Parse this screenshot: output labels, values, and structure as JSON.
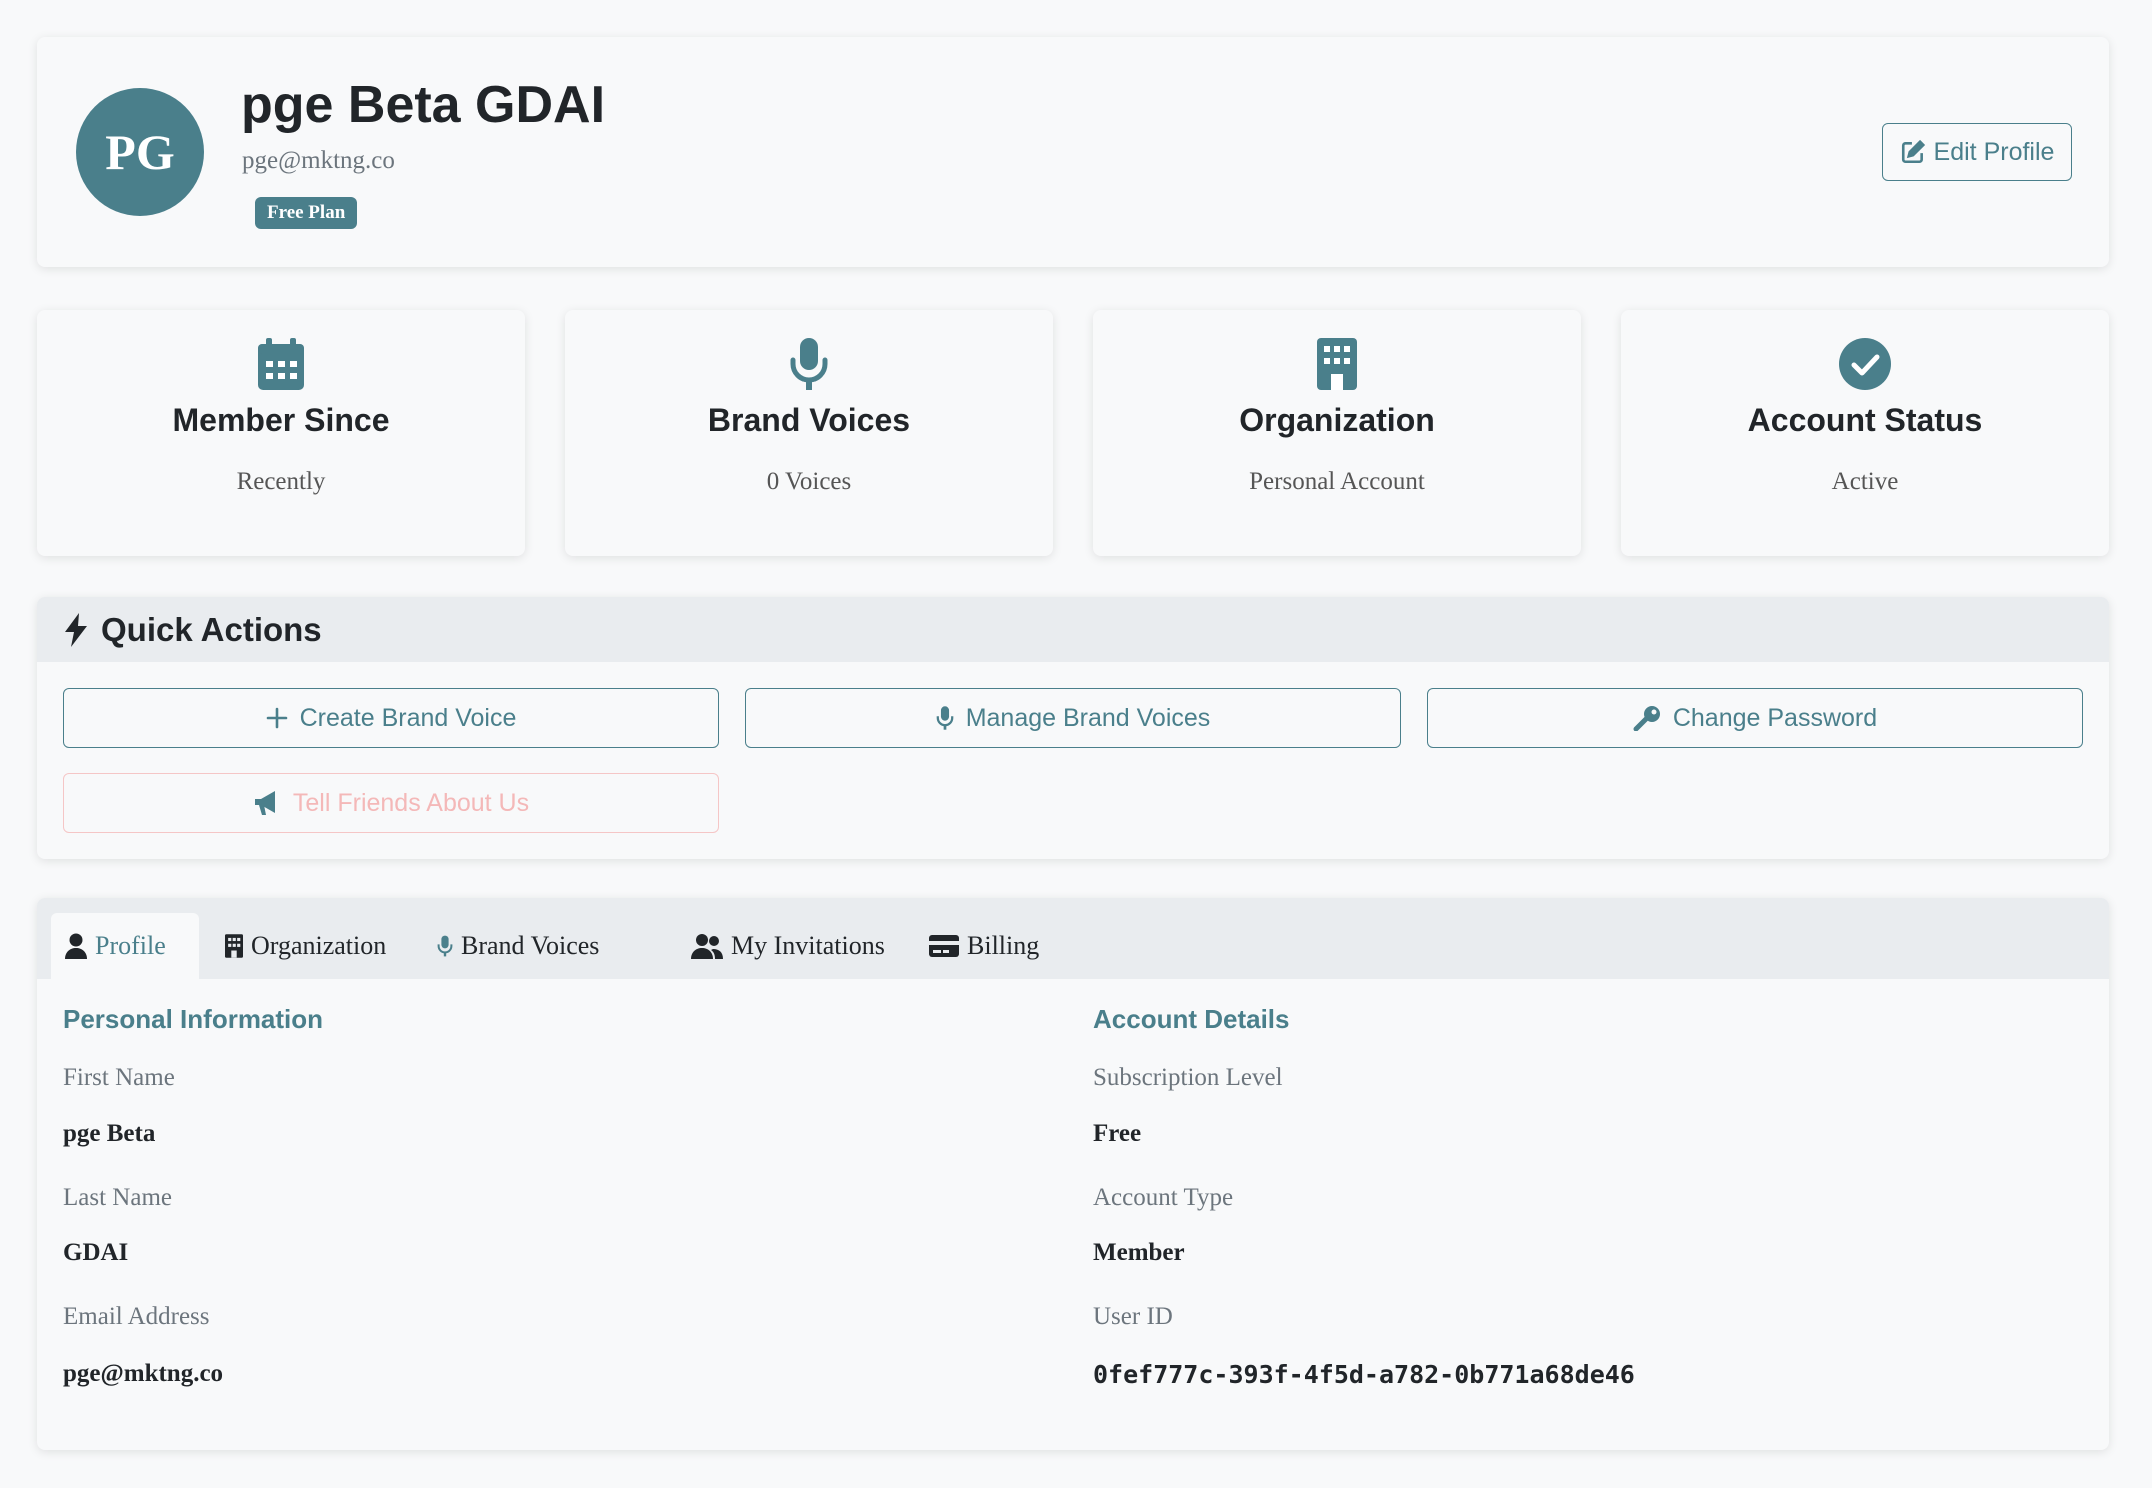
{
  "header": {
    "initials": "PG",
    "name": "pge Beta GDAI",
    "email": "pge@mktng.co",
    "plan_badge": "Free Plan",
    "edit_label": "Edit Profile"
  },
  "stats": [
    {
      "icon": "calendar-icon",
      "title": "Member Since",
      "value": "Recently"
    },
    {
      "icon": "microphone-icon",
      "title": "Brand Voices",
      "value": "0 Voices"
    },
    {
      "icon": "building-icon",
      "title": "Organization",
      "value": "Personal Account"
    },
    {
      "icon": "check-circle-icon",
      "title": "Account Status",
      "value": "Active"
    }
  ],
  "quick_actions": {
    "title": "Quick Actions",
    "buttons": [
      {
        "icon": "plus-icon",
        "label": "Create Brand Voice"
      },
      {
        "icon": "microphone-icon",
        "label": "Manage Brand Voices"
      },
      {
        "icon": "key-icon",
        "label": "Change Password"
      },
      {
        "icon": "megaphone-icon",
        "label": "Tell Friends About Us"
      }
    ]
  },
  "tabs": [
    {
      "icon": "user-icon",
      "label": "Profile",
      "active": true
    },
    {
      "icon": "building-icon",
      "label": "Organization"
    },
    {
      "icon": "microphone-icon",
      "label": "Brand Voices"
    },
    {
      "icon": "users-icon",
      "label": "My Invitations"
    },
    {
      "icon": "credit-card-icon",
      "label": "Billing"
    }
  ],
  "personal_info": {
    "title": "Personal Information",
    "fields": [
      {
        "label": "First Name",
        "value": "pge Beta"
      },
      {
        "label": "Last Name",
        "value": "GDAI"
      },
      {
        "label": "Email Address",
        "value": "pge@mktng.co"
      }
    ]
  },
  "account_details": {
    "title": "Account Details",
    "fields": [
      {
        "label": "Subscription Level",
        "value": "Free"
      },
      {
        "label": "Account Type",
        "value": "Member"
      },
      {
        "label": "User ID",
        "value": "0fef777c-393f-4f5d-a782-0b771a68de46"
      }
    ]
  },
  "colors": {
    "accent": "#4a7f8b",
    "muted": "#6c757d",
    "pink": "#f4b8b8"
  }
}
